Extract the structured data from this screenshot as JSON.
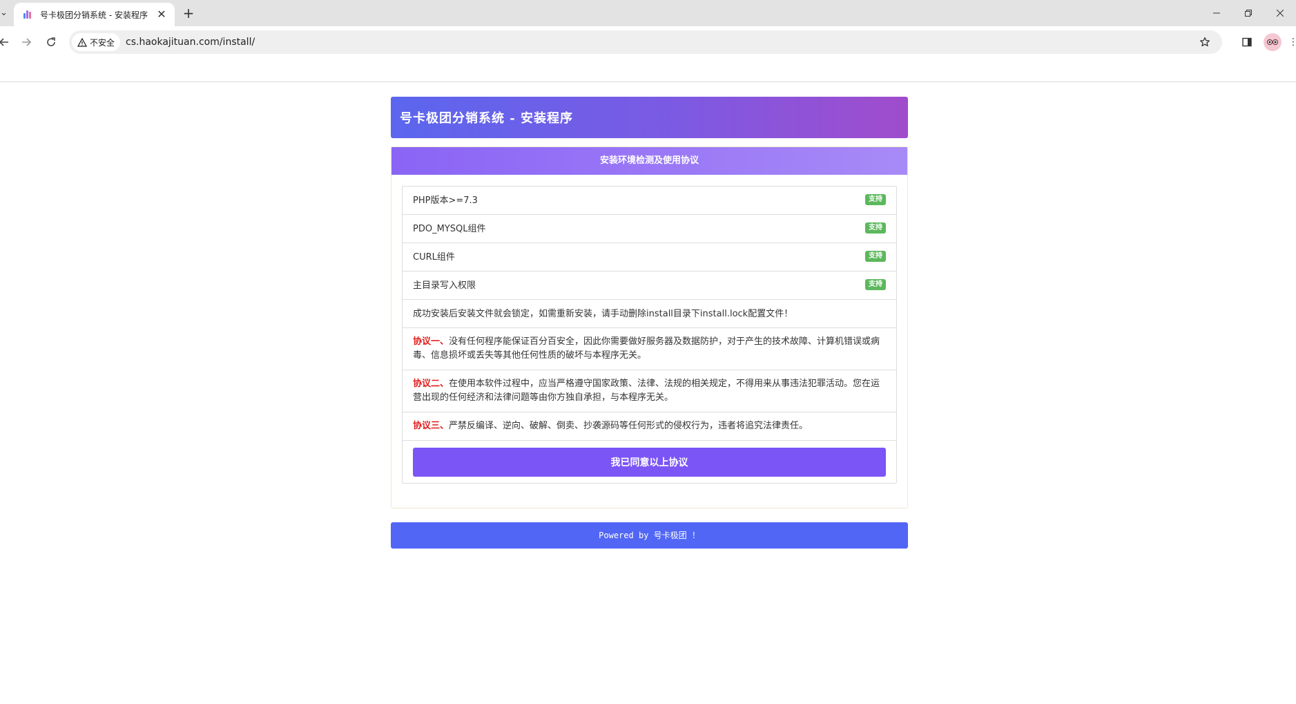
{
  "browser": {
    "tab": {
      "title": "号卡极团分销系统 - 安装程序",
      "close_label": "✕"
    },
    "new_tab_label": "+",
    "security_chip": "不安全",
    "url": "cs.haokajituan.com/install/",
    "icons": {
      "back": "back-arrow-icon",
      "forward": "forward-arrow-icon",
      "reload": "reload-icon",
      "bookmark": "star-icon",
      "side_panel": "side-panel-icon",
      "profile": "profile-avatar-icon",
      "menu": "kebab-menu-icon"
    }
  },
  "page": {
    "title": "号卡极团分销系统 - 安装程序",
    "panel_heading": "安装环境检测及使用协议",
    "checks": [
      {
        "label": "PHP版本>=7.3",
        "status": "支持"
      },
      {
        "label": "PDO_MYSQL组件",
        "status": "支持"
      },
      {
        "label": "CURL组件",
        "status": "支持"
      },
      {
        "label": "主目录写入权限",
        "status": "支持"
      }
    ],
    "note": "成功安装后安装文件就会锁定，如需重新安装，请手动删除install目录下install.lock配置文件！",
    "agreements": [
      {
        "title": "协议一、",
        "text": "没有任何程序能保证百分百安全，因此你需要做好服务器及数据防护，对于产生的技术故障、计算机错误或病毒、信息损坏或丢失等其他任何性质的破坏与本程序无关。"
      },
      {
        "title": "协议二、",
        "text": "在使用本软件过程中，应当严格遵守国家政策、法律、法规的相关规定，不得用来从事违法犯罪活动。您在运营出现的任何经济和法律问题等由你方独自承担，与本程序无关。"
      },
      {
        "title": "协议三、",
        "text": "严禁反编译、逆向、破解、倒卖、抄袭源码等任何形式的侵权行为，违者将追究法律责任。"
      }
    ],
    "agree_button": "我已同意以上协议",
    "footer": "Powered by 号卡极团 ！"
  },
  "colors": {
    "header_gradient_start": "#5b66ee",
    "header_gradient_end": "#a04ccc",
    "panel_heading": "#8a64f5",
    "button": "#7b55f6",
    "footer": "#5166f5",
    "badge": "#5cb85c",
    "agreement_title": "#e21b1b"
  }
}
